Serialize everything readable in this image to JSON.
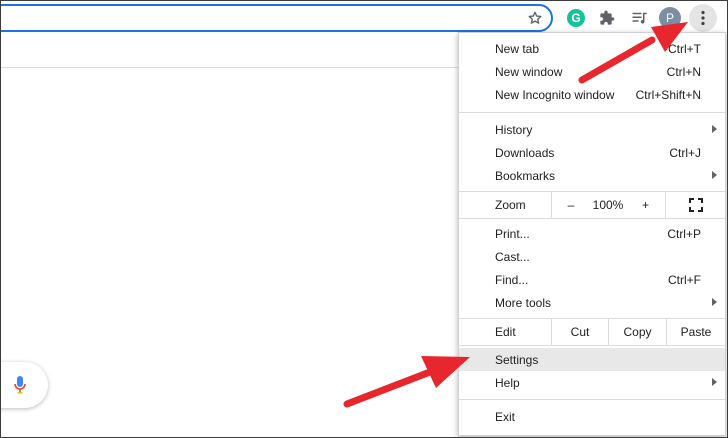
{
  "toolbar": {
    "profile_initial": "P",
    "grammarly_letter": "G",
    "icons": [
      "star-icon",
      "grammarly-icon",
      "puzzle-icon",
      "media-control-icon",
      "profile-avatar",
      "more-vert-icon"
    ]
  },
  "menu": {
    "new_tab": {
      "label": "New tab",
      "shortcut": "Ctrl+T"
    },
    "new_window": {
      "label": "New window",
      "shortcut": "Ctrl+N"
    },
    "new_incognito": {
      "label": "New Incognito window",
      "shortcut": "Ctrl+Shift+N"
    },
    "history": {
      "label": "History"
    },
    "downloads": {
      "label": "Downloads",
      "shortcut": "Ctrl+J"
    },
    "bookmarks": {
      "label": "Bookmarks"
    },
    "zoom": {
      "label": "Zoom",
      "minus": "–",
      "level": "100%",
      "plus": "+"
    },
    "print": {
      "label": "Print...",
      "shortcut": "Ctrl+P"
    },
    "cast": {
      "label": "Cast..."
    },
    "find": {
      "label": "Find...",
      "shortcut": "Ctrl+F"
    },
    "more_tools": {
      "label": "More tools"
    },
    "edit": {
      "label": "Edit",
      "cut": "Cut",
      "copy": "Copy",
      "paste": "Paste"
    },
    "settings": {
      "label": "Settings"
    },
    "help": {
      "label": "Help"
    },
    "exit": {
      "label": "Exit"
    }
  },
  "colors": {
    "accent": "#1a73e8",
    "annotation_arrow": "#e8262d",
    "highlight": "#e8e8e8"
  }
}
